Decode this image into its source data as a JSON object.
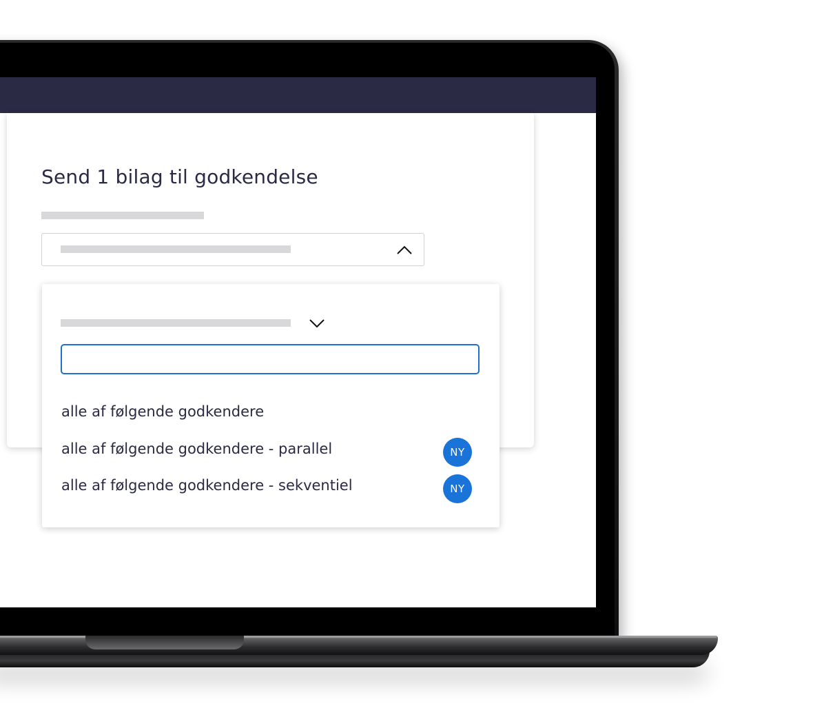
{
  "dialog": {
    "title": "Send 1 bilag til godkendelse"
  },
  "dropdown": {
    "search_value": "",
    "options": [
      {
        "label": "alle af følgende godkendere",
        "badge": ""
      },
      {
        "label": "alle af følgende godkendere - parallel",
        "badge": "NY"
      },
      {
        "label": "alle af følgende godkendere - sekventiel",
        "badge": "NY"
      }
    ]
  },
  "icons": {
    "select_toggle": "chevron-up-icon",
    "group_toggle": "chevron-down-icon"
  },
  "colors": {
    "topbar": "#2a2a45",
    "text": "#2a2a45",
    "accent": "#1f6fcf",
    "badge": "#1a73d9",
    "placeholder": "#d8d8da"
  }
}
